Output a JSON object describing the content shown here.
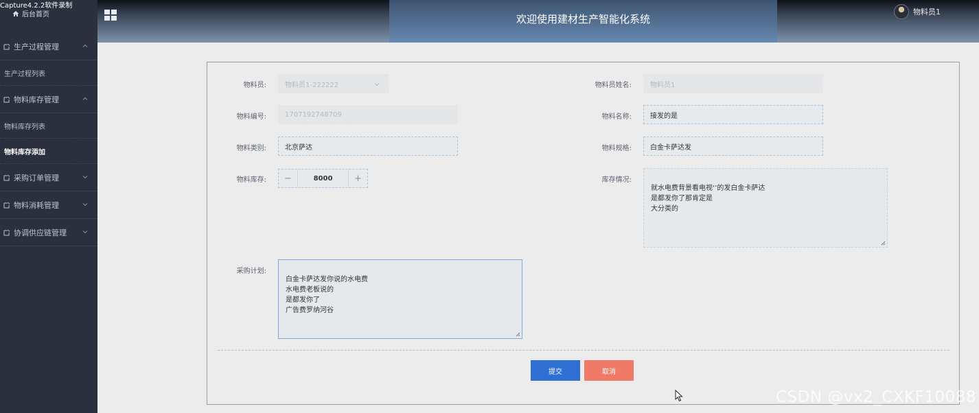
{
  "capture_label": "Capture4.2.2软件录制",
  "sidebar": {
    "home_label": "后台首页",
    "items": [
      {
        "type": "group",
        "label": "生产过程管理",
        "expanded": true
      },
      {
        "type": "sub",
        "label": "生产过程列表"
      },
      {
        "type": "group",
        "label": "物料库存管理",
        "expanded": true
      },
      {
        "type": "sub",
        "label": "物料库存列表"
      },
      {
        "type": "sub",
        "label": "物料库存添加",
        "active": true
      },
      {
        "type": "group",
        "label": "采购订单管理",
        "expanded": false
      },
      {
        "type": "group",
        "label": "物料消耗管理",
        "expanded": false
      },
      {
        "type": "group",
        "label": "协调供应链管理",
        "expanded": false
      }
    ]
  },
  "header": {
    "title": "欢迎使用建材生产智能化系统",
    "user_name": "物料员1"
  },
  "form": {
    "operator": {
      "label": "物料员:",
      "value": "物料员1-222222"
    },
    "operator_name": {
      "label": "物料员姓名:",
      "value": "物料员1"
    },
    "code": {
      "label": "物料编号:",
      "value": "1707192748709"
    },
    "name": {
      "label": "物料名称:",
      "value": "接发的是"
    },
    "category": {
      "label": "物料类别:",
      "value": "北京萨达"
    },
    "spec": {
      "label": "物料规格:",
      "value": "白金卡萨达发"
    },
    "stock": {
      "label": "物料库存:",
      "value": "8000",
      "minus": "−",
      "plus": "+"
    },
    "stock_status": {
      "label": "库存情况:",
      "value": "就水电费背景看电视‘’的发白金卡萨达\n是都发你了那肯定是\n大分类的"
    },
    "purchase_plan": {
      "label": "采购计划:",
      "value": "白金卡萨达发你说的水电费\n水电费老板说的\n是都发你了\n广告费罗纳河谷"
    },
    "submit_label": "提交",
    "cancel_label": "取消"
  },
  "watermark": "CSDN @vx2_CXKF10088",
  "colors": {
    "sidebar_bg": "#2a303d",
    "primary": "#2f6fd4",
    "danger": "#f07a66"
  }
}
